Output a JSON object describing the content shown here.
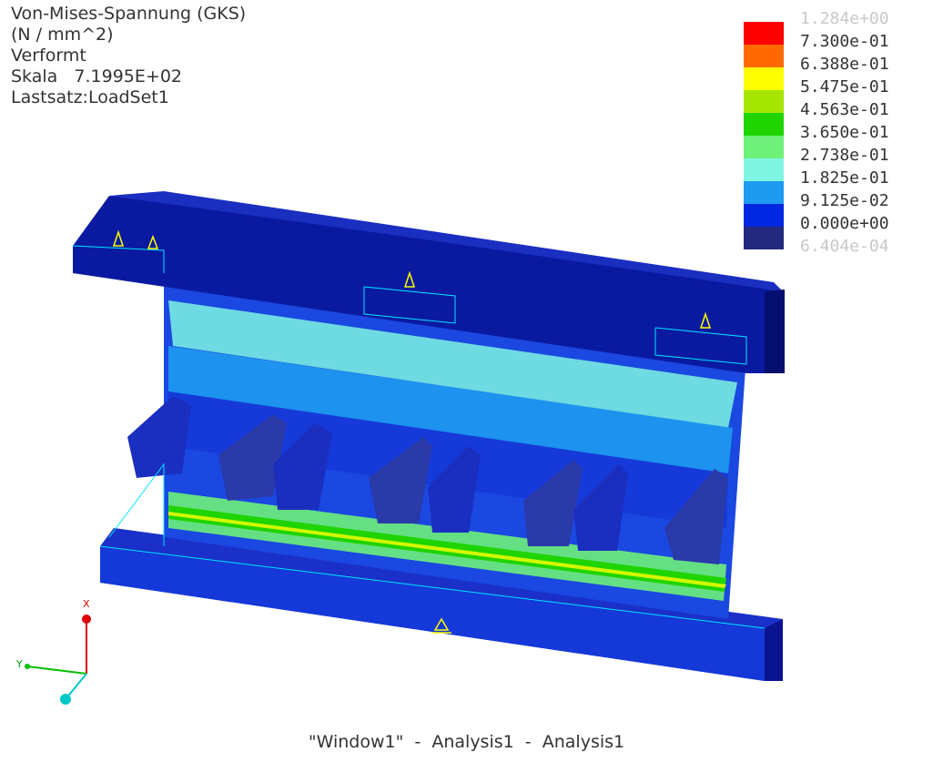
{
  "header": {
    "line1": "Von-Mises-Spannung (GKS)",
    "line2": "(N / mm^2)",
    "line3": "Verformt",
    "line4": "Skala   7.1995E+02",
    "line5": "Lastsatz:LoadSet1"
  },
  "legend": {
    "max_label": "1.284e+00",
    "min_label": "6.404e-04",
    "levels": [
      {
        "label": "7.300e-01",
        "color": "#ff0000"
      },
      {
        "label": "6.388e-01",
        "color": "#ff6a00"
      },
      {
        "label": "5.475e-01",
        "color": "#ffff00"
      },
      {
        "label": "4.563e-01",
        "color": "#a6e600"
      },
      {
        "label": "3.650e-01",
        "color": "#1fd400"
      },
      {
        "label": "2.738e-01",
        "color": "#6ef07a"
      },
      {
        "label": "1.825e-01",
        "color": "#7ef5e0"
      },
      {
        "label": "9.125e-02",
        "color": "#1e9af0"
      },
      {
        "label": "0.000e+00",
        "color": "#0028e0"
      },
      {
        "label": "",
        "color": "#232a80"
      }
    ]
  },
  "axes": {
    "x_label": "X",
    "y_label": "Y"
  },
  "caption": "\"Window1\"  -  Analysis1  -  Analysis1",
  "colors": {
    "body_dark": "#0a1aa0",
    "body_mid": "#1538d8",
    "stress_low": "#7ef5e0",
    "stress_mid": "#1fd400",
    "wireframe": "#00e5ff",
    "constraint": "#ffff00"
  }
}
